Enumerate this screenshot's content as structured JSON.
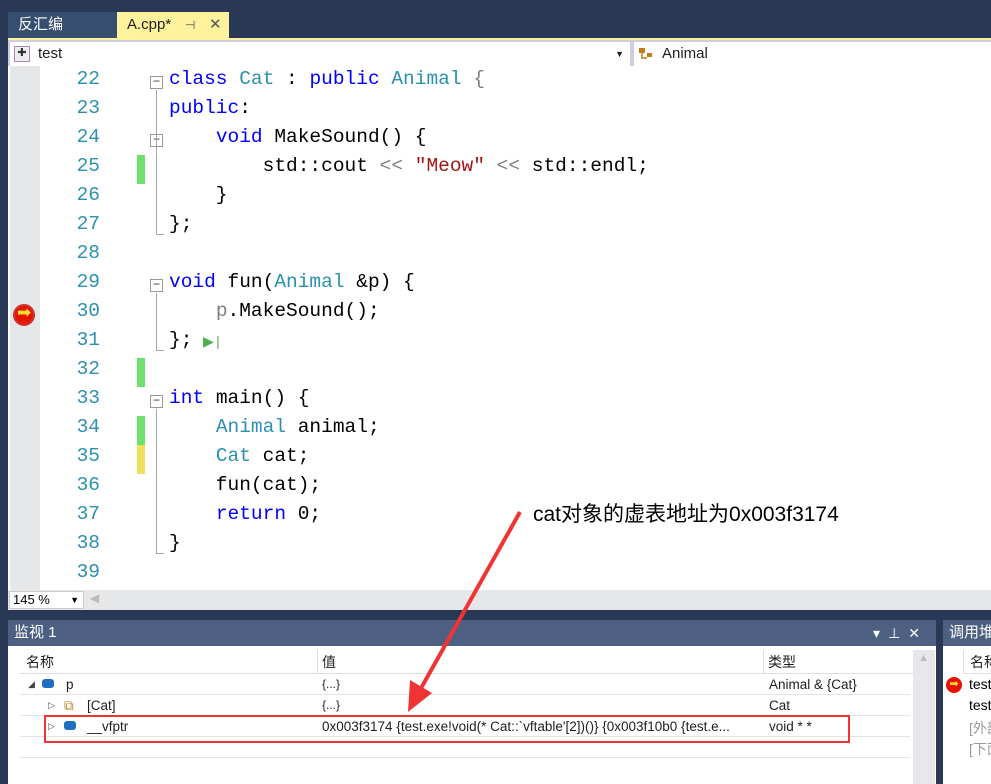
{
  "tabs": [
    {
      "label": "反汇编",
      "active": false
    },
    {
      "label": "A.cpp*",
      "active": true
    }
  ],
  "nav": {
    "scope": "test",
    "member": "Animal"
  },
  "editor": {
    "zoom": "145 %",
    "lines": [
      {
        "n": "22",
        "tokens": [
          [
            "class ",
            "k"
          ],
          [
            "Cat",
            "t"
          ],
          [
            " : ",
            ""
          ],
          [
            "public ",
            "k"
          ],
          [
            "Animal",
            "t"
          ],
          [
            " {",
            "p"
          ]
        ]
      },
      {
        "n": "23",
        "tokens": [
          [
            "public",
            "k"
          ],
          [
            ":",
            ""
          ]
        ]
      },
      {
        "n": "24",
        "tokens": [
          [
            "    ",
            ""
          ],
          [
            "void ",
            "k"
          ],
          [
            "MakeSound() {",
            ""
          ]
        ]
      },
      {
        "n": "25",
        "tokens": [
          [
            "        std::cout ",
            ""
          ],
          [
            "<<",
            "o"
          ],
          [
            " ",
            ""
          ],
          [
            "\"Meow\"",
            "s"
          ],
          [
            " ",
            ""
          ],
          [
            "<<",
            "o"
          ],
          [
            " std::endl;",
            ""
          ]
        ]
      },
      {
        "n": "26",
        "tokens": [
          [
            "    }",
            ""
          ]
        ]
      },
      {
        "n": "27",
        "tokens": [
          [
            "};",
            ""
          ]
        ]
      },
      {
        "n": "28",
        "tokens": []
      },
      {
        "n": "29",
        "tokens": [
          [
            "void ",
            "k"
          ],
          [
            "fun(",
            ""
          ],
          [
            "Animal",
            "t"
          ],
          [
            " &p) {",
            ""
          ]
        ]
      },
      {
        "n": "30",
        "tokens": [
          [
            "    ",
            ""
          ],
          [
            "p",
            "p"
          ],
          [
            ".MakeSound();",
            ""
          ]
        ]
      },
      {
        "n": "31",
        "tokens": [
          [
            "};",
            ""
          ]
        ]
      },
      {
        "n": "32",
        "tokens": []
      },
      {
        "n": "33",
        "tokens": [
          [
            "int ",
            "k"
          ],
          [
            "main() {",
            ""
          ]
        ]
      },
      {
        "n": "34",
        "tokens": [
          [
            "    ",
            ""
          ],
          [
            "Animal",
            "t"
          ],
          [
            " animal;",
            ""
          ]
        ]
      },
      {
        "n": "35",
        "tokens": [
          [
            "    ",
            ""
          ],
          [
            "Cat",
            "t"
          ],
          [
            " cat;",
            ""
          ]
        ]
      },
      {
        "n": "36",
        "tokens": [
          [
            "    fun(cat);",
            ""
          ]
        ]
      },
      {
        "n": "37",
        "tokens": [
          [
            "    ",
            ""
          ],
          [
            "return ",
            "k"
          ],
          [
            "0;",
            ""
          ]
        ]
      },
      {
        "n": "38",
        "tokens": [
          [
            "}",
            ""
          ]
        ]
      },
      {
        "n": "39",
        "tokens": []
      }
    ],
    "current_line": "30",
    "colors": {
      "keyword": "#0000ff",
      "type": "#2b91af",
      "string": "#a31515",
      "saved": "#6ce26c",
      "unsaved": "#f1e05a"
    }
  },
  "watch": {
    "title": "监视 1",
    "columns": {
      "name": "名称",
      "value": "值",
      "type": "类型"
    },
    "rows": [
      {
        "name": "p",
        "value": "{...}",
        "type": "Animal & {Cat}"
      },
      {
        "name": "[Cat]",
        "value": "{...}",
        "type": "Cat"
      },
      {
        "name": "__vfptr",
        "value": "0x003f3174 {test.exe!void(* Cat::`vftable'[2])()} {0x003f10b0 {test.e...",
        "type": "void * *"
      }
    ]
  },
  "callstack": {
    "title": "调用堆栈",
    "column": "名称",
    "rows": [
      "test",
      "test",
      "[外部",
      "[下面"
    ]
  },
  "annotation": {
    "text": "cat对象的虚表地址为0x003f3174",
    "color": "#f03434"
  }
}
